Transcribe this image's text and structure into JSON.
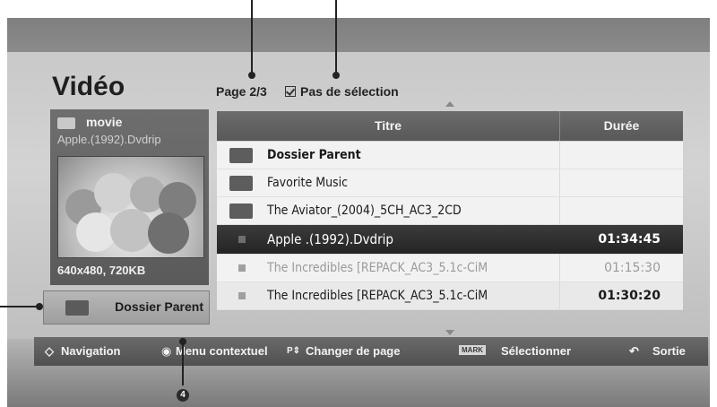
{
  "header": {
    "title": "Vidéo",
    "page_info": "Page 2/3",
    "selection_label": "Pas de sélection"
  },
  "preview": {
    "folder_name": "movie",
    "file_name": "Apple.(1992).Dvdrip",
    "resolution": "640x480, 720KB"
  },
  "parent_button": {
    "label": "Dossier Parent"
  },
  "table": {
    "headers": {
      "title": "Titre",
      "duration": "Durée"
    },
    "rows": [
      {
        "name": "Dossier Parent",
        "duration": "",
        "type": "parent"
      },
      {
        "name": "Favorite Music",
        "duration": "",
        "type": "folder"
      },
      {
        "name": "The Aviator_(2004)_5CH_AC3_2CD",
        "duration": "",
        "type": "folder"
      },
      {
        "name": "Apple .(1992).Dvdrip",
        "duration": "01:34:45",
        "type": "file"
      },
      {
        "name": "The Incredibles [REPACK_AC3_5.1c-CiM",
        "duration": "01:15:30",
        "type": "file"
      },
      {
        "name": "The Incredibles [REPACK_AC3_5.1c-CiM",
        "duration": "01:30:20",
        "type": "file"
      }
    ]
  },
  "bottom_bar": {
    "navigation": "Navigation",
    "menu": "Menu contextuel",
    "page": "Changer de page",
    "mark_key": "MARK",
    "select": "Sélectionner",
    "exit": "Sortie"
  },
  "callouts": {
    "four": "4"
  },
  "icons": [
    "folder-icon",
    "parent-folder-icon",
    "checkbox-icon",
    "nav-arrows-icon",
    "ok-button-icon",
    "page-key-icon",
    "mark-key-icon",
    "exit-icon"
  ]
}
